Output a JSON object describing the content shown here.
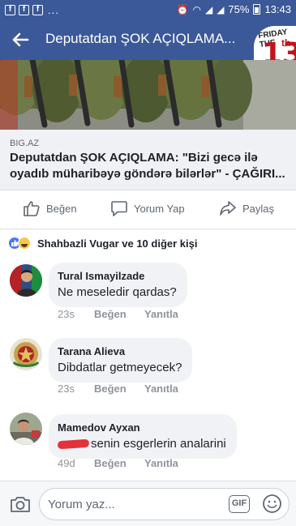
{
  "status_bar": {
    "battery": "75%",
    "time": "13:43",
    "dots": "..."
  },
  "app_bar": {
    "title": "Deputatdan ŞOK AÇIQLAMA...",
    "badge_word": "FRIDAY THE",
    "badge_number": "13",
    "badge_suffix": "th",
    "color": "#3b5998"
  },
  "link_preview": {
    "domain": "BIG.AZ",
    "title": "Deputatdan ŞOK AÇIQLAMA: \"Bizi gecə ilə oyadıb müharibəyə göndərə bilərlər\" - ÇAĞIRI..."
  },
  "actions": {
    "like": "Beğen",
    "comment": "Yorum Yap",
    "share": "Paylaş"
  },
  "reactions": {
    "summary": "Shahbazli Vugar ve 10 diğer kişi",
    "types": [
      "like",
      "haha"
    ]
  },
  "comments": [
    {
      "name": "Tural Ismayilzade",
      "text": "Ne meseledir qardas?",
      "time": "23s",
      "like": "Beğen",
      "reply": "Yanıtla"
    },
    {
      "name": "Tarana Alieva",
      "text": "Dibdatlar getmeyecek?",
      "time": "23s",
      "like": "Beğen",
      "reply": "Yanıtla"
    },
    {
      "name": "Mamedov Ayxan",
      "text": "senin esgerlerin analarini",
      "time": "49d",
      "like": "Beğen",
      "reply": "Yanıtla"
    }
  ],
  "composer": {
    "placeholder": "Yorum yaz...",
    "gif_label": "GIF"
  }
}
